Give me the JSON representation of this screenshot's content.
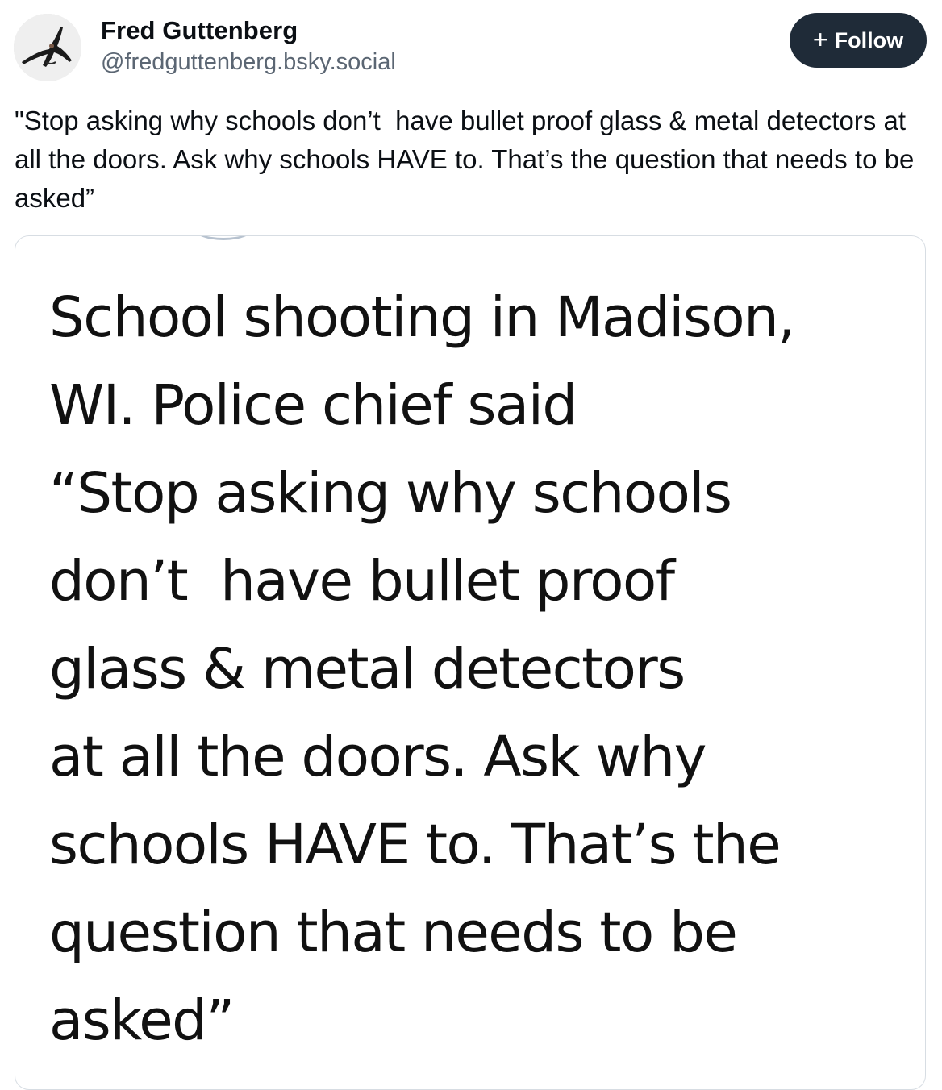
{
  "post": {
    "author": {
      "display_name": "Fred Guttenberg",
      "handle": "@fredguttenberg.bsky.social",
      "avatar_icon": "person-photo-avatar"
    },
    "follow_button": {
      "icon": "plus-icon",
      "plus_glyph": "+",
      "label": "Follow",
      "bg_color": "#1f2b38"
    },
    "text": "\"Stop asking why schools don’t  have bullet proof glass & metal detectors at all the doors. Ask why schools HAVE to. That’s the question that needs to be asked”",
    "embed": {
      "image_text": "School shooting in Madison,\nWI. Police chief said\n“Stop asking why schools\ndon’t  have bullet proof\nglass & metal detectors\nat all the doors. Ask why\nschools HAVE to. That’s the\nquestion that needs to be\nasked”"
    }
  }
}
